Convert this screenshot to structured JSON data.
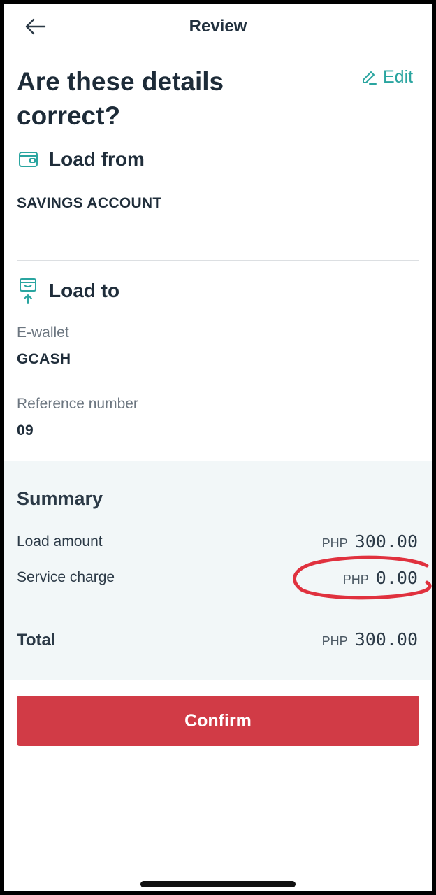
{
  "header": {
    "title": "Review"
  },
  "page": {
    "heading": "Are these details correct?",
    "edit_label": "Edit"
  },
  "load_from": {
    "title": "Load from",
    "account": "SAVINGS ACCOUNT"
  },
  "load_to": {
    "title": "Load to",
    "ewallet_label": "E-wallet",
    "ewallet_value": "GCASH",
    "reference_label": "Reference number",
    "reference_value": "09"
  },
  "summary": {
    "title": "Summary",
    "rows": [
      {
        "label": "Load amount",
        "currency": "PHP",
        "amount": "300.00"
      },
      {
        "label": "Service charge",
        "currency": "PHP",
        "amount": "0.00"
      }
    ],
    "total": {
      "label": "Total",
      "currency": "PHP",
      "amount": "300.00"
    }
  },
  "actions": {
    "confirm_label": "Confirm"
  },
  "colors": {
    "accent": "#2aa5a0",
    "confirm": "#d13b46",
    "summary_bg": "#f2f7f8",
    "annotation": "#e0313e"
  }
}
